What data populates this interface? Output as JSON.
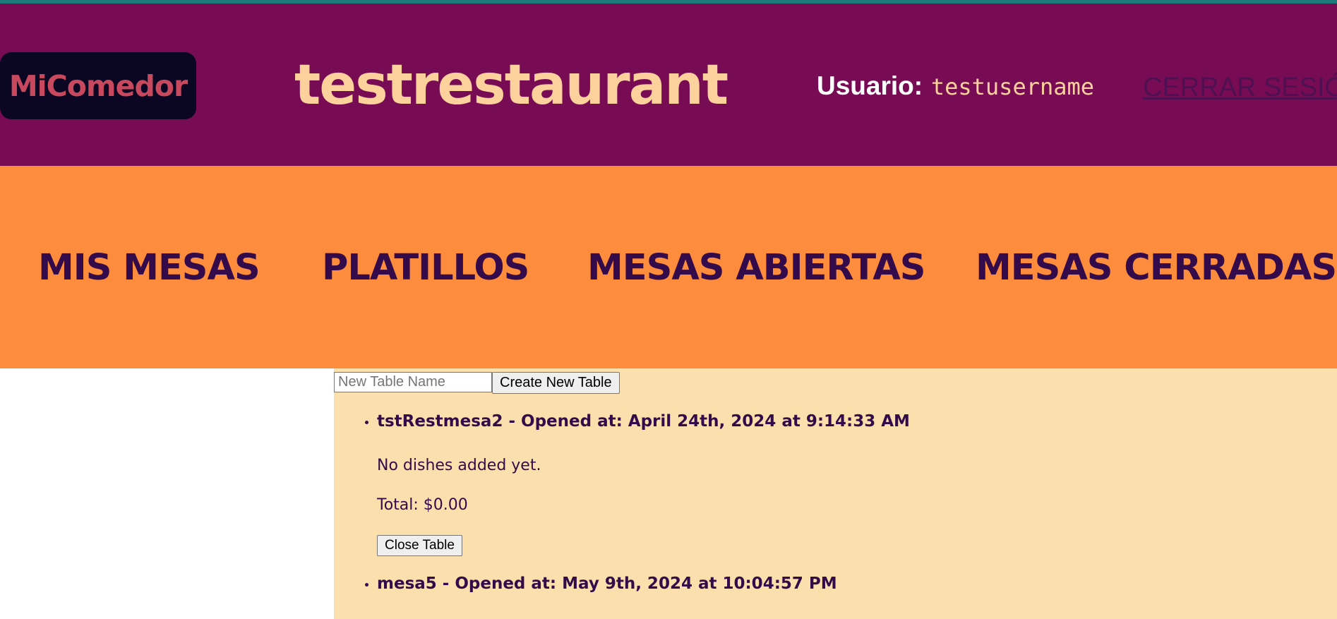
{
  "header": {
    "logo_text": "MiComedor",
    "restaurant_name": "testrestaurant",
    "user_label": "Usuario:",
    "username": "testusername",
    "logout_label": "CERRAR SESIÓN"
  },
  "nav": {
    "items": [
      {
        "label": "MIS MESAS"
      },
      {
        "label": "PLATILLOS"
      },
      {
        "label": "MESAS ABIERTAS"
      },
      {
        "label": "MESAS CERRADAS"
      }
    ]
  },
  "main": {
    "new_table_placeholder": "New Table Name",
    "new_table_value": "",
    "create_button_label": "Create New Table",
    "tables": [
      {
        "heading": "tstRestmesa2 - Opened at: April 24th, 2024 at 9:14:33 AM",
        "dishes_text": "No dishes added yet.",
        "total_text": "Total: $0.00",
        "close_button_label": "Close Table"
      },
      {
        "heading": "mesa5 - Opened at: May 9th, 2024 at 10:04:57 PM"
      }
    ]
  },
  "colors": {
    "header_bg": "#780c54",
    "nav_bg": "#fd8c3c",
    "content_bg": "#fbe0ae",
    "accent_text": "#fcd19c",
    "dark_text": "#330a4a"
  }
}
